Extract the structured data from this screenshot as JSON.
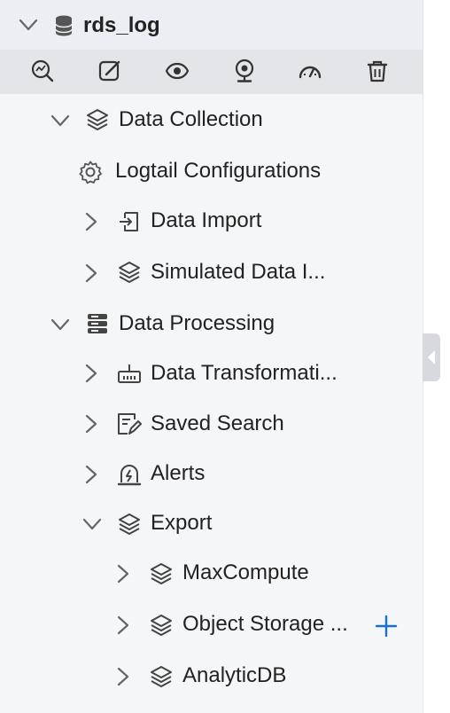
{
  "header": {
    "title": "rds_log",
    "icon": "database-icon"
  },
  "toolbar": {
    "buttons": [
      {
        "name": "query-analysis",
        "icon": "search-chart-icon"
      },
      {
        "name": "edit",
        "icon": "edit-icon"
      },
      {
        "name": "view",
        "icon": "eye-icon"
      },
      {
        "name": "monitor",
        "icon": "webcam-icon"
      },
      {
        "name": "dashboard",
        "icon": "speedometer-icon"
      },
      {
        "name": "delete",
        "icon": "trash-icon"
      }
    ]
  },
  "tree": {
    "data_collection": {
      "label": "Data Collection",
      "icon": "layers-icon"
    },
    "logtail_configurations": {
      "label": "Logtail Configurations",
      "icon": "gear-icon"
    },
    "data_import": {
      "label": "Data Import",
      "icon": "import-icon"
    },
    "simulated_data_import": {
      "label": "Simulated Data I...",
      "icon": "layers-icon"
    },
    "data_processing": {
      "label": "Data Processing",
      "icon": "server-stack-icon"
    },
    "data_transformation": {
      "label": "Data Transformati...",
      "icon": "transform-icon"
    },
    "saved_search": {
      "label": "Saved Search",
      "icon": "saved-search-icon"
    },
    "alerts": {
      "label": "Alerts",
      "icon": "alarm-icon"
    },
    "export": {
      "label": "Export",
      "icon": "layers-icon"
    },
    "maxcompute": {
      "label": "MaxCompute",
      "icon": "layers-icon"
    },
    "object_storage": {
      "label": "Object Storage ...",
      "icon": "layers-icon"
    },
    "analyticdb": {
      "label": "AnalyticDB",
      "icon": "layers-icon"
    }
  },
  "colors": {
    "accent": "#1a6fd6",
    "panel_bg": "#f5f6f8",
    "header_bg": "#eceef3",
    "toolbar_bg": "#e4e5e8"
  }
}
